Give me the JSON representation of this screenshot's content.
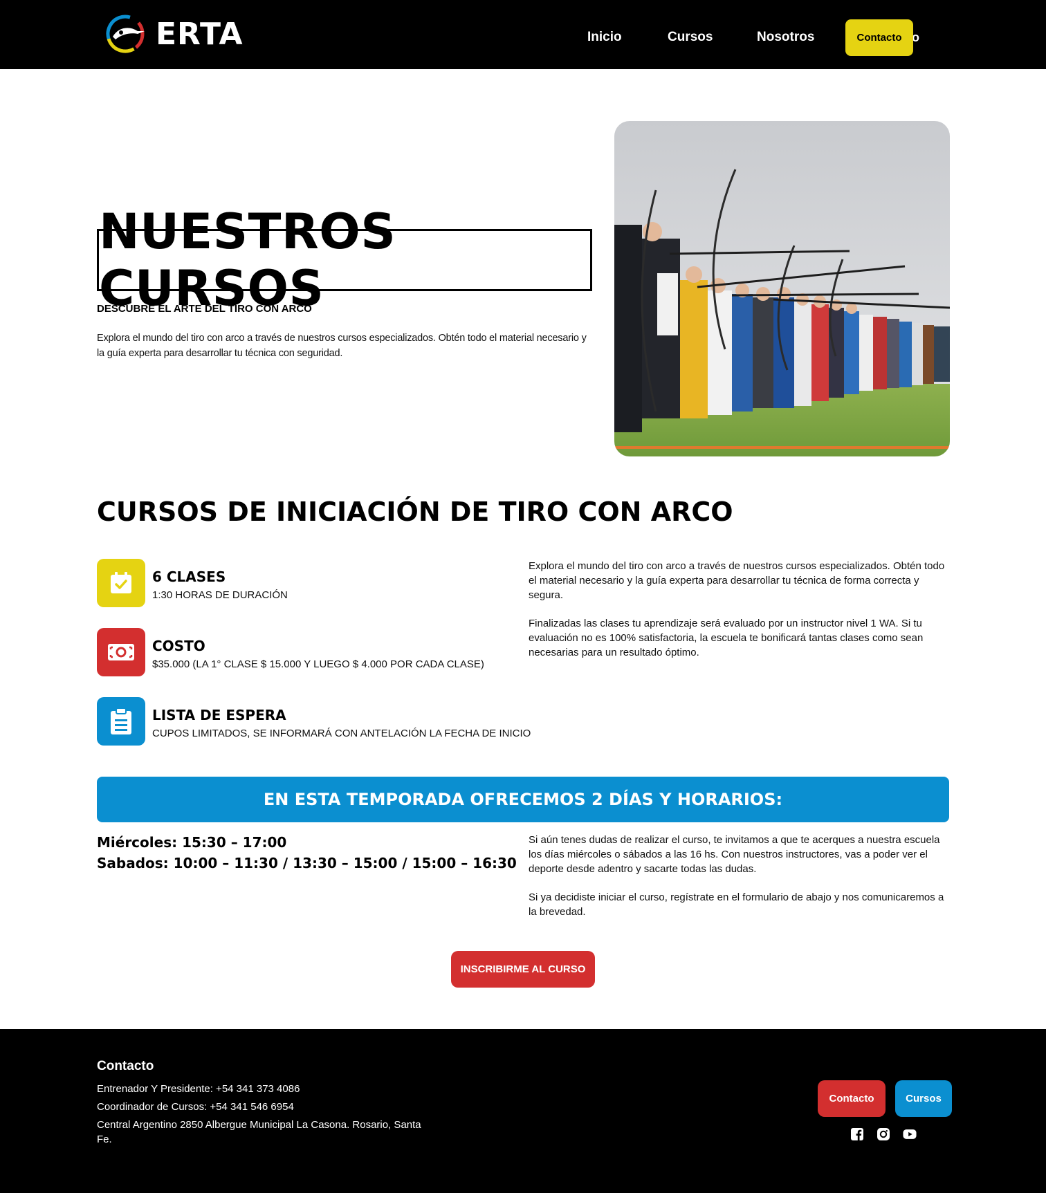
{
  "header": {
    "logo_text": "ERTA",
    "nav": [
      "Inicio",
      "Cursos",
      "Nosotros"
    ],
    "contact_button": "Contacto"
  },
  "hero": {
    "title": "NUESTROS CURSOS",
    "subtitle": "DESCUBRE EL ARTE DEL TIRO CON ARCO",
    "description": "Explora el mundo del tiro con arco a través de nuestros cursos especializados. Obtén todo el material necesario y la guía experta para desarrollar tu técnica con seguridad.",
    "image": "archers-at-range-photo"
  },
  "course": {
    "title": "CURSOS DE INICIACIÓN DE TIRO CON ARCO",
    "features": [
      {
        "icon": "calendar-check-icon",
        "color": "#e5d312",
        "title": "6 CLASES",
        "subtitle": "1:30 HORAS DE DURACIÓN"
      },
      {
        "icon": "money-icon",
        "color": "#d32f2f",
        "title": "COSTO",
        "subtitle": "$35.000  (LA 1° CLASE $ 15.000 Y LUEGO $ 4.000 POR CADA CLASE)"
      },
      {
        "icon": "clipboard-icon",
        "color": "#0b8fd0",
        "title": "LISTA DE ESPERA",
        "subtitle": "CUPOS LIMITADOS, SE INFORMARÁ CON ANTELACIÓN LA FECHA DE INICIO"
      }
    ],
    "paragraphs": [
      "Explora el mundo del tiro con arco a través de nuestros cursos especializados. Obtén todo el material necesario y la guía experta para desarrollar tu técnica de forma correcta y segura.",
      "Finalizadas las clases tu aprendizaje será evaluado por un instructor nivel 1 WA. Si tu evaluación no es 100% satisfactoria, la escuela te bonificará tantas clases como sean necesarias para un resultado óptimo."
    ]
  },
  "season": {
    "banner": "EN ESTA TEMPORADA OFRECEMOS 2 DÍAS Y HORARIOS:",
    "schedule": [
      "Miércoles: 15:30 – 17:00",
      "Sabados: 10:00 – 11:30 / 13:30 – 15:00 / 15:00 – 16:30"
    ],
    "paragraphs": [
      "Si aún tenes dudas de realizar el curso, te invitamos a que te acerques a nuestra escuela los días miércoles o sábados a las 16 hs. Con nuestros instructores, vas a poder ver el deporte desde adentro y sacarte todas las dudas.",
      "Si ya decidiste iniciar el curso, regístrate en el formulario de abajo y nos comunicaremos a la brevedad."
    ],
    "cta": "INSCRIBIRME AL CURSO"
  },
  "footer": {
    "title": "Contacto",
    "lines": [
      "Entrenador Y Presidente: +54 341 373 4086",
      "Coordinador de Cursos: +54 341 546 6954",
      "Central Argentino 2850 Albergue Municipal La Casona. Rosario, Santa Fe."
    ],
    "buttons": [
      "Contacto",
      "Cursos"
    ],
    "social": [
      "facebook-icon",
      "instagram-icon",
      "youtube-icon"
    ]
  },
  "colors": {
    "yellow": "#e5d312",
    "red": "#d32f2f",
    "blue": "#0b8fd0",
    "black": "#000000"
  }
}
